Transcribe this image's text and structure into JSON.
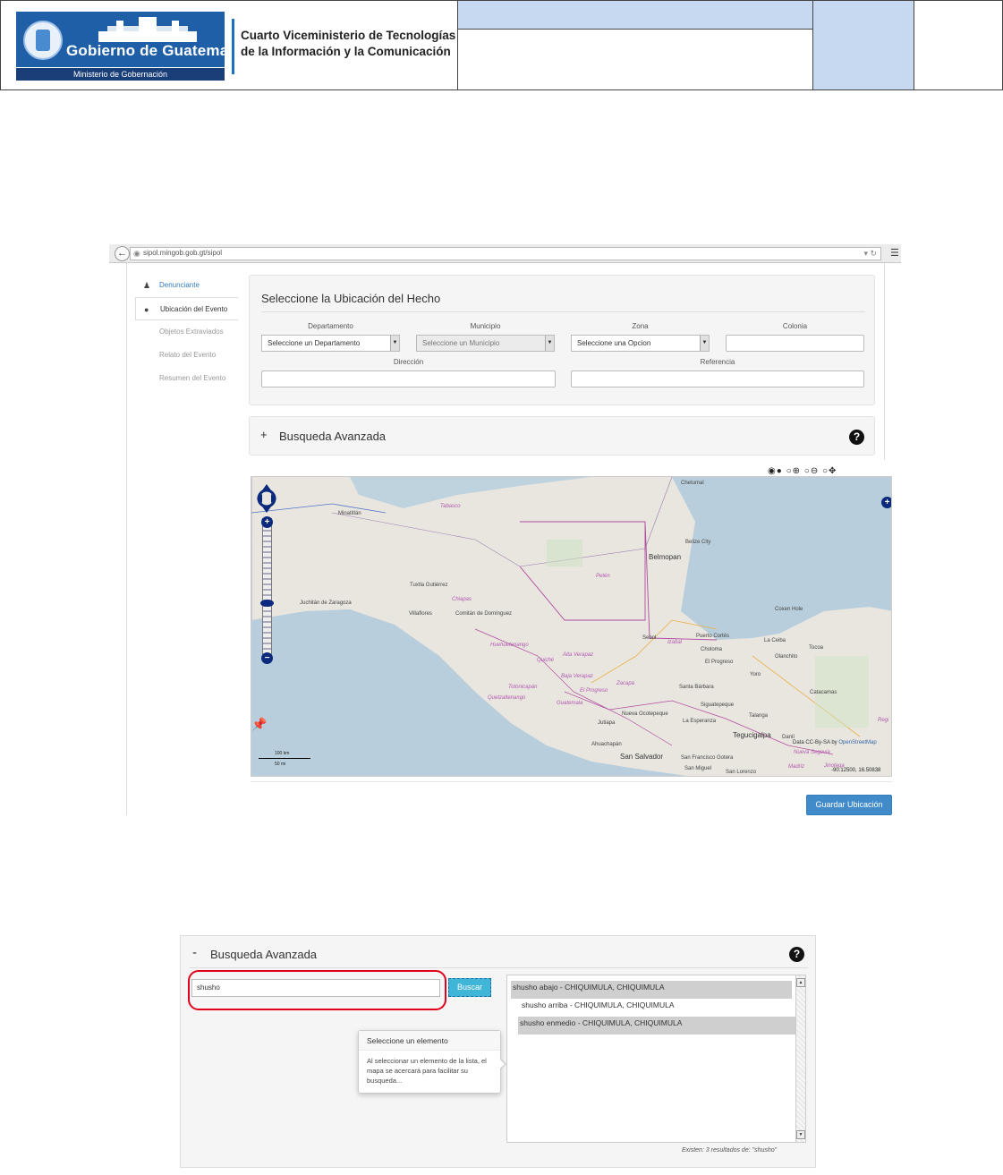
{
  "header": {
    "logo_title": "Gobierno de Guatemala",
    "logo_ministry": "Ministerio de Gobernación",
    "vice_title_line1": "Cuarto Viceministerio de Tecnologías",
    "vice_title_line2": "de la Información y la Comunicación",
    "accent_color": "#c6d9f1"
  },
  "screenshot1": {
    "browser": {
      "url": "sipol.mingob.gob.gt/sipol"
    },
    "sidebar": {
      "items": [
        {
          "label": "Denunciante",
          "icon": "user-icon"
        },
        {
          "label": "Ubicación del Evento",
          "icon": "map-marker-icon"
        },
        {
          "label": "Objetos Extraviados",
          "icon": ""
        },
        {
          "label": "Relato del Evento",
          "icon": ""
        },
        {
          "label": "Resumen del Evento",
          "icon": ""
        }
      ]
    },
    "location_panel": {
      "title": "Seleccione la Ubicación del Hecho",
      "departamento_label": "Departamento",
      "departamento_value": "Seleccione un Departamento",
      "municipio_label": "Municipio",
      "municipio_value": "Seleccione un Municipio",
      "zona_label": "Zona",
      "zona_value": "Seleccione una Opcion",
      "colonia_label": "Colonia",
      "direccion_label": "Dirección",
      "referencia_label": "Referencia"
    },
    "advanced_search": {
      "sign": "+",
      "label": "Busqueda Avanzada",
      "help": "?"
    },
    "map": {
      "labels": {
        "chetumal": "Chetumal",
        "minatitlan": "Minatitlán",
        "tabasco": "Tabasco",
        "belize_city": "Belize City",
        "belmopan": "Belmopan",
        "peten": "Petén",
        "tuxtla": "Tuxtla Gutiérrez",
        "chiapas": "Chiapas",
        "juchitan": "Juchitán de Zaragoza",
        "villaflores": "Villaflores",
        "comitan": "Comitán de Domínguez",
        "coxen_hole": "Coxen Hole",
        "huehuetenango": "Huehuetenango",
        "alta_verapaz": "Alta Verapaz",
        "quiche": "Quiché",
        "sebol": "Sebol",
        "izabal": "Izabal",
        "puerto_cortes": "Puerto Cortés",
        "la_ceiba": "La Ceiba",
        "tocoa": "Tocoa",
        "choloma": "Choloma",
        "el_progreso_hn": "El Progreso",
        "olanchito": "Olanchito",
        "baja_verapaz": "Baja Verapaz",
        "totonicapan": "Totonicapán",
        "el_progreso": "El Progreso",
        "zacapa": "Zacapa",
        "yoro": "Yoro",
        "santa_barbara": "Santa Bárbara",
        "catacamas": "Catacamas",
        "quetzaltenango": "Quetzaltenango",
        "guatemala": "Guatemala",
        "siguatepeque": "Siguatepeque",
        "jutiapa": "Jutiapa",
        "nueva_ocotepeque": "Nueva Ocotepeque",
        "la_esperanza": "La Esperanza",
        "talanga": "Talanga",
        "tegucigalpa": "Tegucigalpa",
        "danli": "Danlí",
        "ahuachapan": "Ahuachapán",
        "san_salvador": "San Salvador",
        "san_francisco_gotera": "San Francisco Gotera",
        "nueva_segovia": "Nueva Segovia",
        "san_miguel": "San Miguel",
        "san_lorenzo": "San Lorenzo",
        "madriz": "Madriz",
        "jinotega": "Jinotega",
        "regi": "Regi",
        "scale_km": "100 km",
        "scale_mi": "50 mi",
        "attribution_prefix": "Data CC-By-SA by",
        "attribution_link": "OpenStreetMap",
        "coordinates": "-90.12500, 16.50838"
      }
    },
    "save_button": "Guardar Ubicación"
  },
  "screenshot2": {
    "sign": "-",
    "label": "Busqueda Avanzada",
    "help": "?",
    "search_value": "shusho",
    "search_button": "Buscar",
    "results": [
      {
        "text": "shusho abajo - CHIQUIMULA, CHIQUIMULA",
        "selected": true
      },
      {
        "text": "shusho arriba - CHIQUIMULA, CHIQUIMULA",
        "selected": false
      },
      {
        "text": "shusho enmedio - CHIQUIMULA, CHIQUIMULA",
        "selected": true
      }
    ],
    "popover_title": "Seleccione un elemento",
    "popover_body": "Al seleccionar un elemento de la lista, el mapa se acercará para facilitar su busqueda...",
    "results_count": "Existen: 3 resultados de: \"shusho\""
  }
}
